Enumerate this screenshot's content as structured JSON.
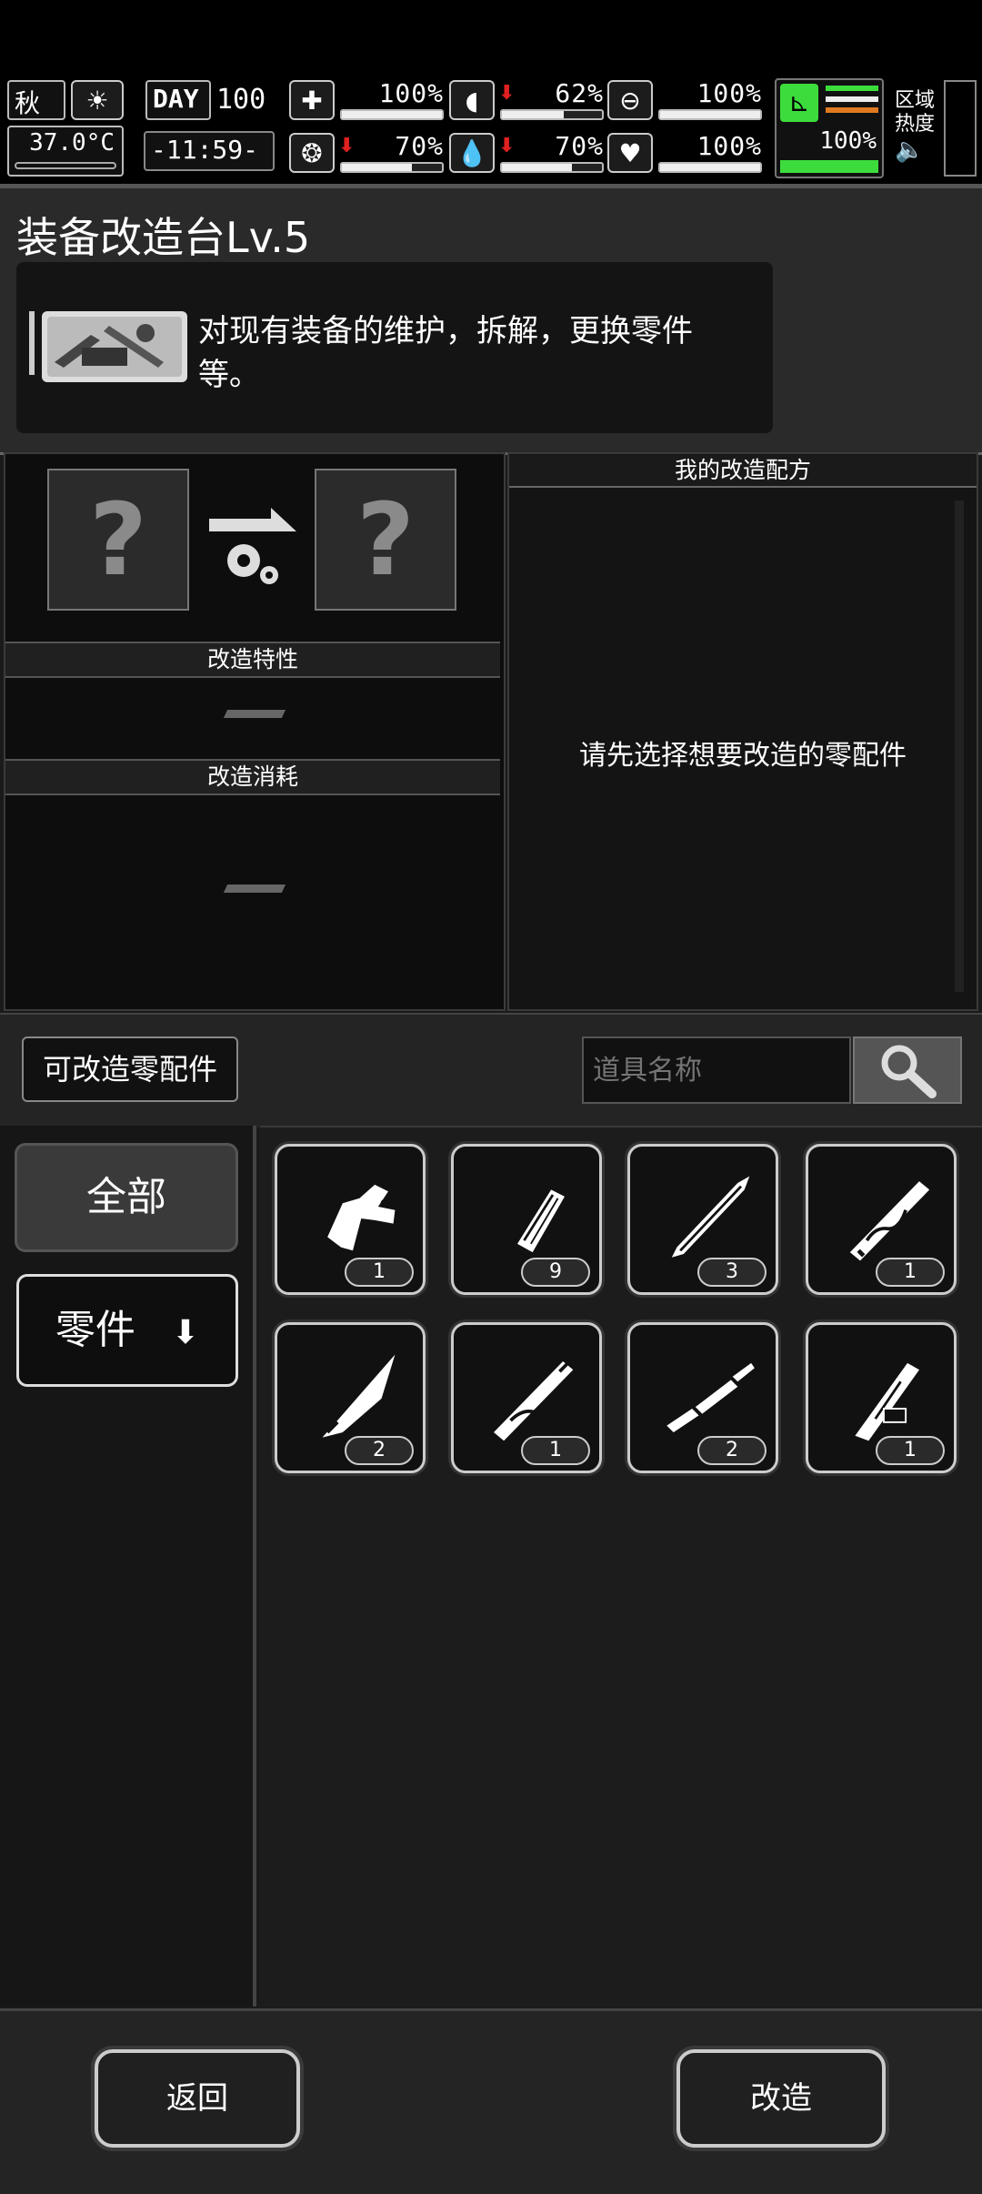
{
  "hud": {
    "season": "秋",
    "temperature": "37.0°C",
    "day_label": "DAY",
    "day_value": "100",
    "time": "-11:59-",
    "stats": [
      {
        "icon": "medkit-icon",
        "value": "100%",
        "level": 1.0,
        "down": false
      },
      {
        "icon": "stomach-icon",
        "value": "62%",
        "level": 0.62,
        "down": true
      },
      {
        "icon": "bandage-icon",
        "value": "100%",
        "level": 1.0,
        "down": false
      },
      {
        "icon": "brain-icon",
        "value": "70%",
        "level": 0.7,
        "down": true
      },
      {
        "icon": "water-drop-icon",
        "value": "70%",
        "level": 0.7,
        "down": true
      },
      {
        "icon": "heart-icon",
        "value": "100%",
        "level": 1.0,
        "down": false
      }
    ],
    "stamina_value": "100%",
    "stamina_level": 1.0,
    "zone_heat_line1": "区域",
    "zone_heat_line2": "热度",
    "accent_green": "#3ddc3d",
    "accent_orange": "#e07a20"
  },
  "header": {
    "title": "装备改造台Lv.5",
    "description": "对现有装备的维护，拆解，更换零件等。"
  },
  "mod_panel": {
    "input_placeholder": "?",
    "output_placeholder": "?",
    "traits_label": "改造特性",
    "traits_value": "",
    "cost_label": "改造消耗",
    "cost_value": ""
  },
  "recipe_panel": {
    "title": "我的改造配方",
    "hint": "请先选择想要改造的零配件"
  },
  "filter": {
    "modifiable_parts_label": "可改造零配件",
    "search_placeholder": "道具名称"
  },
  "categories": [
    {
      "label": "全部"
    },
    {
      "label": "零件"
    }
  ],
  "items": [
    {
      "name": "trigger-part-icon",
      "count": "1"
    },
    {
      "name": "wood-handle-icon",
      "count": "9"
    },
    {
      "name": "blade-icon",
      "count": "3"
    },
    {
      "name": "patterned-handle-icon",
      "count": "1"
    },
    {
      "name": "dagger-blade-icon",
      "count": "2"
    },
    {
      "name": "patterned-grip-icon",
      "count": "1"
    },
    {
      "name": "barrel-icon",
      "count": "2"
    },
    {
      "name": "tagged-handle-icon",
      "count": "1"
    }
  ],
  "buttons": {
    "back": "返回",
    "modify": "改造"
  }
}
